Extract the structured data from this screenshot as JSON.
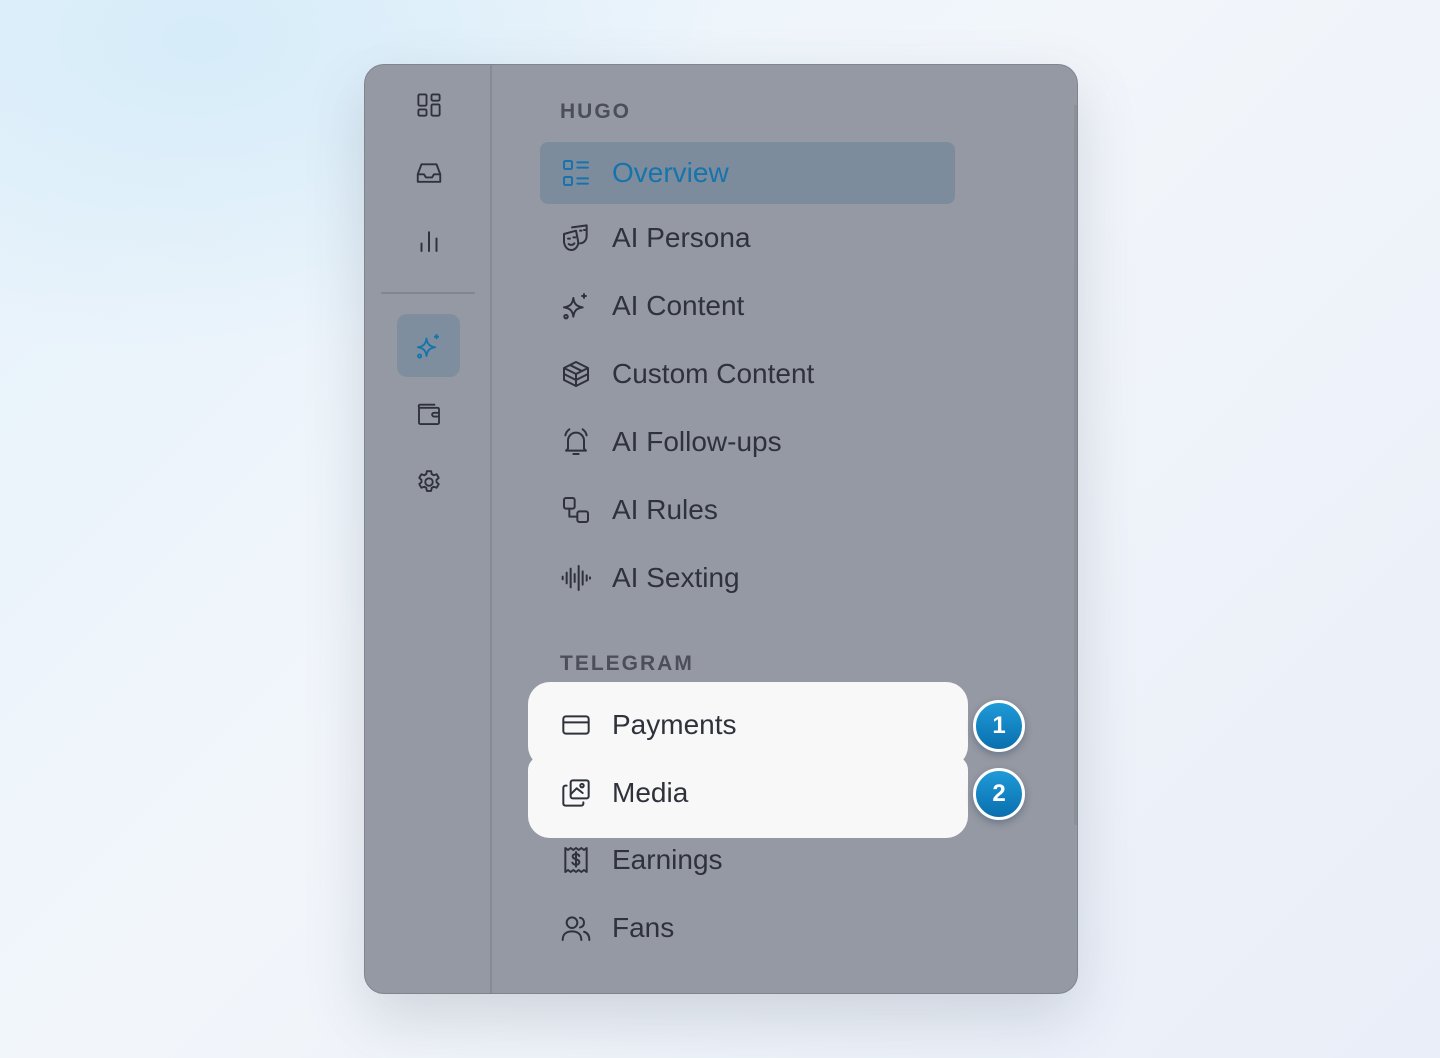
{
  "rail": {
    "icons": [
      "dashboard-icon",
      "inbox-icon",
      "analytics-icon",
      "sparkles-icon",
      "wallet-icon",
      "settings-icon"
    ],
    "active_index": 3
  },
  "sections": [
    {
      "title": "HUGO",
      "items": [
        {
          "label": "Overview",
          "icon": "overview-list-icon",
          "active": true
        },
        {
          "label": "AI Persona",
          "icon": "masks-icon"
        },
        {
          "label": "AI Content",
          "icon": "sparkles-icon"
        },
        {
          "label": "Custom Content",
          "icon": "box-icon"
        },
        {
          "label": "AI Follow-ups",
          "icon": "bell-ringing-icon"
        },
        {
          "label": "AI Rules",
          "icon": "shapes-icon"
        },
        {
          "label": "AI Sexting",
          "icon": "audio-wave-icon"
        }
      ]
    },
    {
      "title": "TELEGRAM",
      "items": [
        {
          "label": "Payments",
          "icon": "credit-card-icon",
          "highlighted": true
        },
        {
          "label": "Media",
          "icon": "photos-icon",
          "highlighted": true
        },
        {
          "label": "Earnings",
          "icon": "receipt-dollar-icon"
        },
        {
          "label": "Fans",
          "icon": "users-icon"
        }
      ]
    }
  ],
  "badges": [
    "1",
    "2"
  ],
  "colors": {
    "panel": "#9599a3",
    "active_bg": "#7d8c9d",
    "accent": "#1674ad",
    "badge": "#0a84c8",
    "highlight_card": "#f8f8f9"
  }
}
